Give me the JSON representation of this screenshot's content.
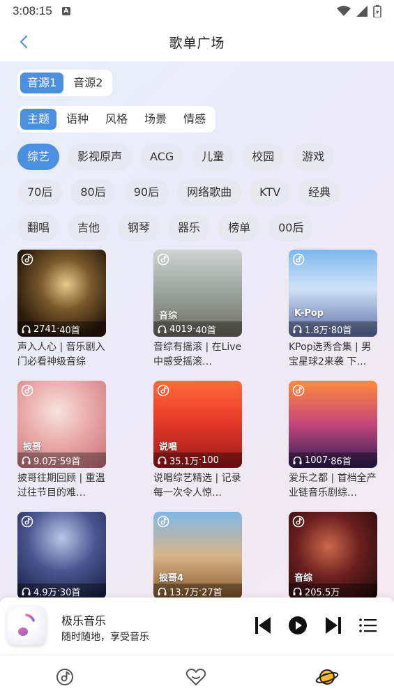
{
  "status_bar": {
    "time": "3:08:15",
    "sim_badge": "A",
    "icons": [
      "wifi-icon",
      "signal-icon",
      "battery-icon"
    ]
  },
  "header": {
    "title": "歌单广场",
    "back_icon": "chevron-left-icon"
  },
  "source_tabs": [
    "音源1",
    "音源2"
  ],
  "source_active": 0,
  "category_tabs": [
    "主题",
    "语种",
    "风格",
    "场景",
    "情感"
  ],
  "category_active": 0,
  "tag_rows": [
    [
      "综艺",
      "影视原声",
      "ACG",
      "儿童",
      "校园",
      "游戏"
    ],
    [
      "70后",
      "80后",
      "90后",
      "网络歌曲",
      "KTV",
      "经典"
    ],
    [
      "翻唱",
      "吉他",
      "钢琴",
      "器乐",
      "榜单",
      "00后"
    ]
  ],
  "tag_active": "综艺",
  "playlists": [
    {
      "tag": "",
      "plays": "2741",
      "tracks": "40首",
      "desc": "声入人心 | 音乐剧入门必看神级音综",
      "style": 0
    },
    {
      "tag": "音综",
      "plays": "4019",
      "tracks": "40首",
      "desc": "音综有摇滚 | 在Live中感受摇滚…",
      "style": 1
    },
    {
      "tag": "K-Pop",
      "plays": "1.8万",
      "tracks": "80首",
      "desc": "KPop选秀合集 | 男宝星球2来袭 下…",
      "style": 2
    },
    {
      "tag": "披哥",
      "plays": "9.0万",
      "tracks": "59首",
      "desc": "披哥往期回顾 | 重温过往节目的难…",
      "style": 3
    },
    {
      "tag": "说唱",
      "plays": "35.1万",
      "tracks": "100",
      "desc": "说唱综艺精选 | 记录每一次令人惊…",
      "style": 4
    },
    {
      "tag": "",
      "plays": "1007",
      "tracks": "86首",
      "desc": "爱乐之都 | 首档全产业链音乐剧综…",
      "style": 5
    },
    {
      "tag": "",
      "plays": "4.9万",
      "tracks": "30首",
      "desc": "",
      "style": 6
    },
    {
      "tag": "披哥4",
      "plays": "13.7万",
      "tracks": "27首",
      "desc": "",
      "style": 7
    },
    {
      "tag": "音综",
      "plays": "205.5万",
      "tracks": "",
      "desc": "",
      "style": 8
    }
  ],
  "player": {
    "app_name": "极乐音乐",
    "slogan": "随时随地，享受音乐",
    "controls": [
      "previous-icon",
      "play-icon",
      "next-icon",
      "playlist-icon"
    ]
  },
  "tabbar": [
    "music-disc-icon",
    "heart-icon",
    "planet-icon"
  ],
  "colors": {
    "accent": "#4a8fe0",
    "background": "#ebeaf5"
  }
}
